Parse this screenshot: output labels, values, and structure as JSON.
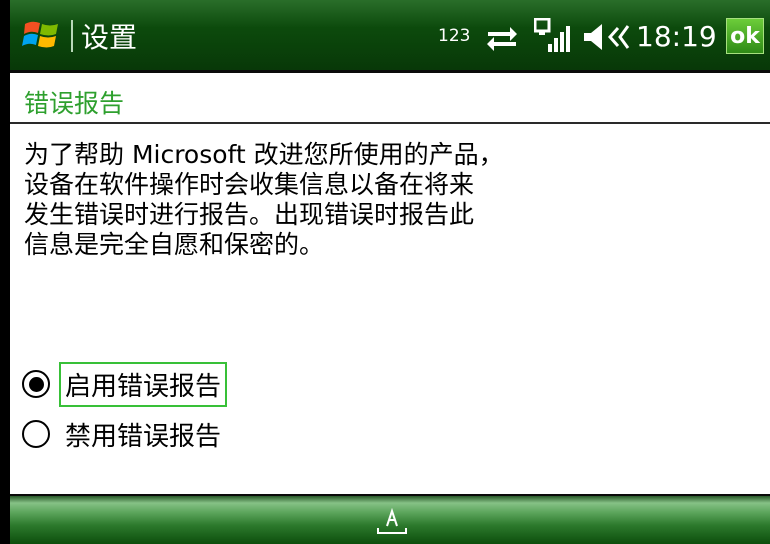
{
  "titlebar": {
    "title": "设置",
    "status_text": "123",
    "clock": "18:19",
    "ok_label": "ok",
    "icons": [
      "windows-start-icon",
      "connectivity-icon",
      "signal-strength-icon",
      "volume-icon"
    ]
  },
  "page": {
    "title": "错误报告",
    "description_lines": [
      "为了帮助 Microsoft 改进您所使用的产品，",
      "设备在软件操作时会收集信息以备在将来",
      "发生错误时进行报告。出现错误时报告此",
      "信息是完全自愿和保密的。"
    ]
  },
  "options": [
    {
      "label": "启用错误报告",
      "selected": true,
      "focused": true
    },
    {
      "label": "禁用错误报告",
      "selected": false,
      "focused": false
    }
  ],
  "softbar": {
    "icons": [
      "keyboard-input-icon"
    ]
  },
  "colors": {
    "titlebar": "#0c4a0c",
    "accent": "#2ea02e",
    "ok_button": "#4caf2a",
    "focus": "#38c038"
  }
}
